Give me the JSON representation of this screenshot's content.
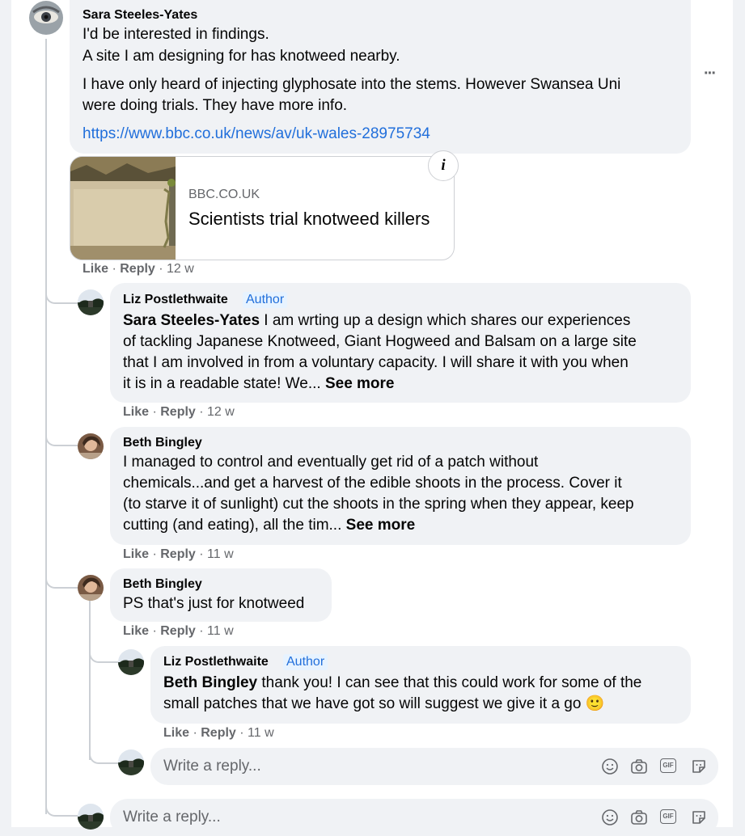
{
  "root_comment": {
    "author": "Sara Steeles-Yates",
    "lines": [
      "I'd be interested in findings.",
      "A site I am designing for has knotweed nearby.",
      "I have only heard of injecting glyphosate into the stems. However Swansea Uni",
      "were doing trials. They have more info."
    ],
    "link": "https://www.bbc.co.uk/news/av/uk-wales-28975734",
    "preview": {
      "domain": "BBC.CO.UK",
      "title": "Scientists trial knotweed killers",
      "info_glyph": "i"
    },
    "more_glyph": "···",
    "like": "Like",
    "reply": "Reply",
    "time": "12 w"
  },
  "replies": [
    {
      "author": "Liz Postlethwaite",
      "badge": "Author",
      "mention": "Sara Steeles-Yates",
      "lines": [
        " I am wrting up a design which shares our experiences",
        "of tackling Japanese Knotweed, Giant Hogweed and Balsam on a large site",
        "that I am involved in from a voluntary capacity. I will share it with you when",
        "it is in a readable state! We... "
      ],
      "see_more": "See more",
      "like": "Like",
      "reply": "Reply",
      "time": "12 w"
    },
    {
      "author": "Beth Bingley",
      "lines": [
        "I managed to control and eventually get rid of a patch without",
        "chemicals...and get a harvest of the edible shoots in the process. Cover it",
        "(to starve it of sunlight) cut the shoots in the spring when they appear, keep",
        "cutting (and eating), all the tim... "
      ],
      "see_more": "See more",
      "like": "Like",
      "reply": "Reply",
      "time": "11 w"
    },
    {
      "author": "Beth Bingley",
      "lines": [
        "PS that's just for knotweed"
      ],
      "like": "Like",
      "reply": "Reply",
      "time": "11 w"
    }
  ],
  "nested_reply": {
    "author": "Liz Postlethwaite",
    "badge": "Author",
    "mention": "Beth Bingley",
    "lines": [
      " thank you! I can see that this could work for some of the",
      "small patches that we have got so will suggest we give it a go "
    ],
    "emoji": "🙂",
    "like": "Like",
    "reply": "Reply",
    "time": "11 w"
  },
  "reply_boxes": [
    {
      "placeholder": "Write a reply..."
    },
    {
      "placeholder": "Write a reply..."
    }
  ],
  "toolbar_icons": [
    "emoji-icon",
    "camera-icon",
    "gif-icon",
    "sticker-icon"
  ],
  "gif_label": "GIF",
  "colors": {
    "link": "#216fdb",
    "bubble": "#f0f2f5",
    "meta": "#65676b",
    "badge_bg": "#e7f3ff"
  }
}
